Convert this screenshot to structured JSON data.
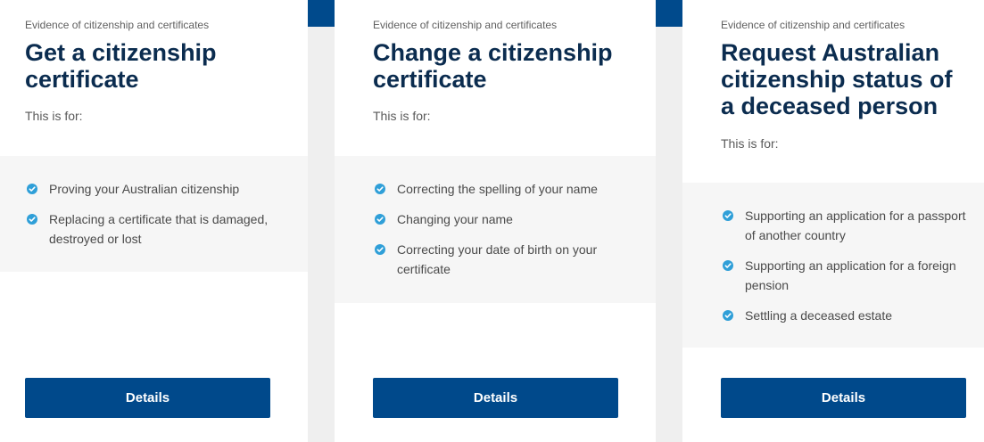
{
  "cards": [
    {
      "eyebrow": "Evidence of citizenship and certificates",
      "title": "Get a citizenship certificate",
      "this_is_for": "This is for:",
      "items": [
        "Proving your Australian citizenship",
        "Replacing a certificate that is damaged, destroyed or lost"
      ],
      "button": "Details"
    },
    {
      "eyebrow": "Evidence of citizenship and certificates",
      "title": "Change a citizenship certificate",
      "this_is_for": "This is for:",
      "items": [
        "Correcting the spelling of your name",
        "Changing your name",
        "Correcting your date of birth on your certificate"
      ],
      "button": "Details"
    },
    {
      "eyebrow": "Evidence of citizenship and certificates",
      "title": "Request Australian citizenship status of a deceased person",
      "this_is_for": "This is for:",
      "items": [
        "Supporting an application for a passport of another country",
        "Supporting an application for a foreign pension",
        "Settling a deceased estate"
      ],
      "button": "Details"
    }
  ],
  "colors": {
    "accent": "#00498b",
    "title": "#0b2c4f",
    "check": "#2f9fd8",
    "page_bg": "#efefef",
    "list_bg": "#f6f6f6"
  },
  "icons": {
    "bullet": "check-circle-icon"
  }
}
